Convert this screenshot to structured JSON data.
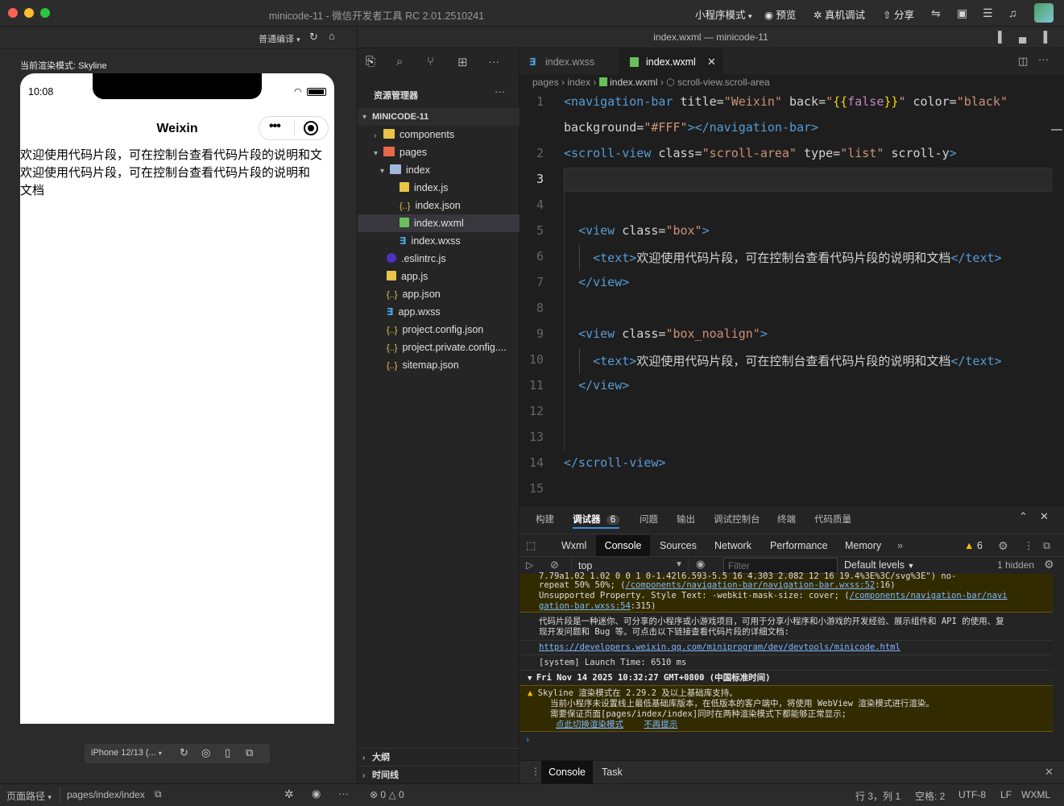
{
  "titlebar": {
    "title": "minicode-11 - 微信开发者工具 RC 2.01.2510241",
    "mode_label": "小程序模式",
    "preview_label": "预览",
    "debug_label": "真机调试",
    "share_label": "分享",
    "traffic_colors": [
      "#ff5f57",
      "#febc2e",
      "#28c840"
    ]
  },
  "simulator": {
    "compile_label": "普通编译",
    "render_mode": "当前渲染模式: Skyline",
    "time": "10:08",
    "nav_title": "Weixin",
    "text_lines": [
      "欢迎使用代码片段，可在控制台查看代码片段的说明和文",
      "欢迎使用代码片段，可在控制台查看代码片段的说明和",
      "文档"
    ],
    "device_label": "iPhone 12/13 (..."
  },
  "editor_header": {
    "title": "index.wxml — minicode-11"
  },
  "explorer": {
    "title": "资源管理器",
    "project": "MINICODE-11",
    "items": [
      {
        "label": "components",
        "icon": "folder-icon"
      },
      {
        "label": "pages",
        "icon": "folder-icon"
      },
      {
        "label": "index",
        "icon": "folder-open-icon"
      },
      {
        "label": "index.js",
        "icon": "js-file-icon"
      },
      {
        "label": "index.json",
        "icon": "json-file-icon"
      },
      {
        "label": "index.wxml",
        "icon": "wxml-file-icon"
      },
      {
        "label": "index.wxss",
        "icon": "wxss-file-icon"
      },
      {
        "label": ".eslintrc.js",
        "icon": "eslint-file-icon"
      },
      {
        "label": "app.js",
        "icon": "js-file-icon"
      },
      {
        "label": "app.json",
        "icon": "json-file-icon"
      },
      {
        "label": "app.wxss",
        "icon": "wxss-file-icon"
      },
      {
        "label": "project.config.json",
        "icon": "json-file-icon"
      },
      {
        "label": "project.private.config....",
        "icon": "json-file-icon"
      },
      {
        "label": "sitemap.json",
        "icon": "json-file-icon"
      }
    ],
    "outline_label": "大纲",
    "timeline_label": "时间线"
  },
  "editor": {
    "tabs": [
      {
        "label": "index.wxss"
      },
      {
        "label": "index.wxml"
      }
    ],
    "breadcrumb": [
      "pages",
      "index",
      "index.wxml",
      "scroll-view.scroll-area"
    ],
    "line_numbers": [
      "1",
      "",
      "2",
      "3",
      "4",
      "5",
      "6",
      "7",
      "8",
      "9",
      "10",
      "11",
      "12",
      "13",
      "14",
      "15"
    ]
  },
  "devtools": {
    "top_tabs": [
      "构建",
      "调试器",
      "问题",
      "输出",
      "调试控制台",
      "终端",
      "代码质量"
    ],
    "debugger_badge": "6",
    "panel_tabs": [
      "Wxml",
      "Console",
      "Sources",
      "Network",
      "Performance",
      "Memory"
    ],
    "warn_count": "6",
    "context": "top",
    "filter_placeholder": "Filter",
    "levels": "Default levels",
    "hidden": "1 hidden",
    "logs": {
      "l1": "7.79a1.02 1.02 0 0 1 0-1.42l6.593-5.5 16 4.303 2.082 12 16 19.4%3E%3C/svg%3E\") no-",
      "l2a": "repeat 50% 50%; (",
      "l2link": "/components/navigation-bar/navigation-bar.wxss:52",
      "l2b": ":16)",
      "l3a": "Unsupported Property. Style Text: -webkit-mask-size: cover; (",
      "l3link": "/components/navigation-bar/navi",
      "l4link": "gation-bar.wxss:54",
      "l4b": ":315)",
      "l5": "代码片段是一种迷你、可分享的小程序或小游戏项目，可用于分享小程序和小游戏的开发经验、展示组件和 API 的使用、复",
      "l6": "现开发问题和 Bug 等。可点击以下链接查看代码片段的详细文档:",
      "l7link": "https://developers.weixin.qq.com/miniprogram/dev/devtools/minicode.html",
      "l8": "[system] Launch Time: 6510 ms",
      "l9": "Fri Nov 14 2025 10:32:27 GMT+0800 (中国标准时间)",
      "l10": "Skyline 渲染模式在 2.29.2 及以上基础库支持。",
      "l11": "当前小程序未设置线上最低基础库版本，在低版本的客户端中，将使用 WebView 渲染模式进行渲染。",
      "l12": "需要保证页面[pages/index/index]同时在两种渲染模式下都能够正常显示;",
      "l13link1": "点此切换渲染模式",
      "l13link2": "不再提示"
    },
    "bottom_tabs": [
      "Console",
      "Task"
    ]
  },
  "statusbar": {
    "page_path_label": "页面路径",
    "page_path": "pages/index/index",
    "errors": "0",
    "warnings": "0",
    "position": "行 3，列 1",
    "spaces": "空格: 2",
    "encoding": "UTF-8",
    "eol": "LF",
    "language": "WXML"
  }
}
